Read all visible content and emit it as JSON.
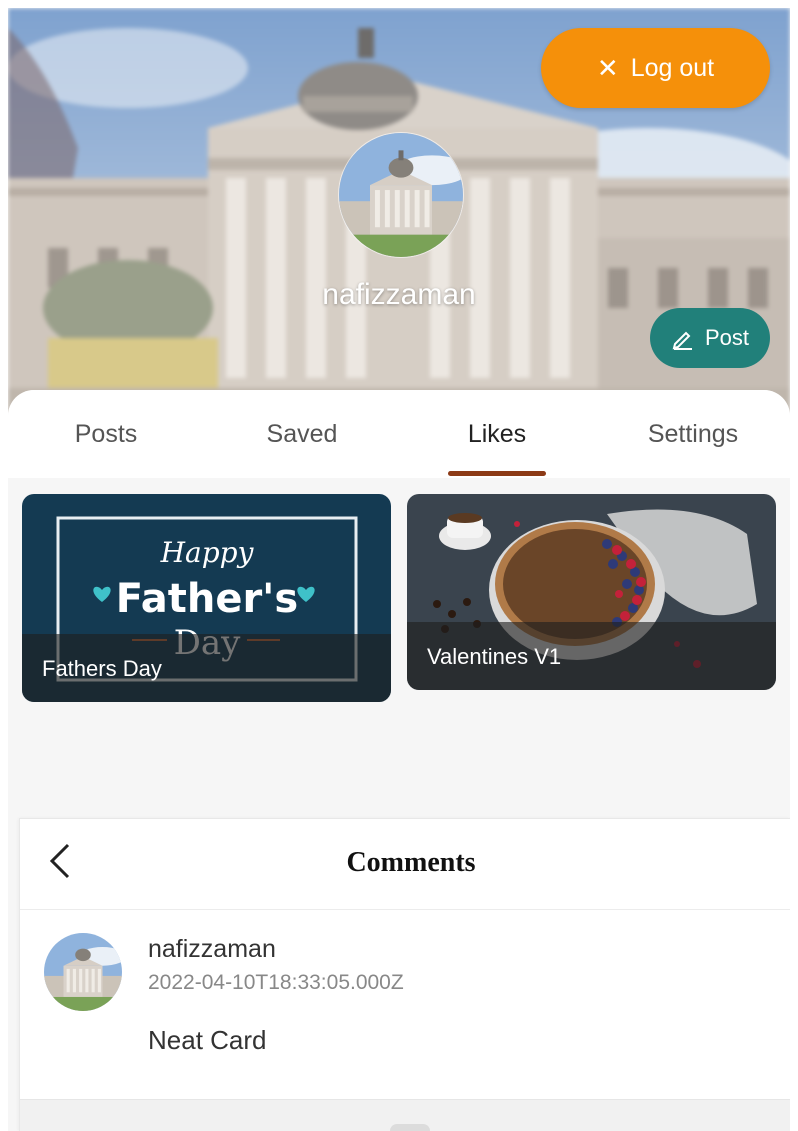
{
  "header": {
    "logout_label": "Log out",
    "username": "nafizzaman",
    "post_label": "Post"
  },
  "tabs": [
    {
      "label": "Posts",
      "active": false
    },
    {
      "label": "Saved",
      "active": false
    },
    {
      "label": "Likes",
      "active": true
    },
    {
      "label": "Settings",
      "active": false
    }
  ],
  "cards": [
    {
      "title": "Fathers Day",
      "image": "happy-fathers-day-card"
    },
    {
      "title": "Valentines V1",
      "image": "berry-tart-card"
    }
  ],
  "comments": {
    "title": "Comments",
    "items": [
      {
        "user": "nafizzaman",
        "timestamp": "2022-04-10T18:33:05.000Z",
        "text": "Neat Card"
      }
    ]
  },
  "fathers_card_art": {
    "happy": "Happy",
    "fathers": "Father's",
    "day": "Day"
  },
  "colors": {
    "logout": "#f5900a",
    "post": "#21807a",
    "tab_indicator": "#8c3a16"
  }
}
